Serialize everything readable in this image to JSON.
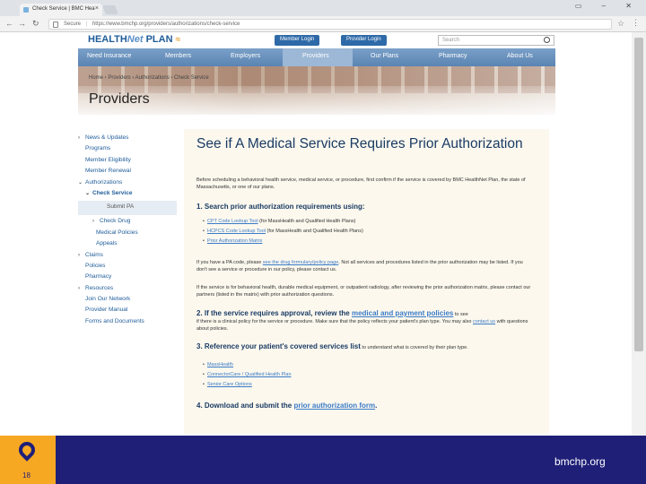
{
  "browser": {
    "tab_title": "Check Service | BMC Hea",
    "tab_close": "×",
    "url_secure": "Secure",
    "url": "https://www.bmchp.org/providers/authorizations/check-service",
    "window_controls": "▭ – ✕"
  },
  "site": {
    "logo_text_1": "HEALTH",
    "logo_text_2": "Net",
    "logo_text_3": " PLAN",
    "member_login": "Member Login",
    "provider_login": "Provider Login",
    "search_placeholder": "Search",
    "nav": [
      "Need Insurance",
      "Members",
      "Employers",
      "Providers",
      "Our Plans",
      "Pharmacy",
      "About Us"
    ],
    "breadcrumb": "Home › Providers › Authorizations › Check Service",
    "page_title": "Providers",
    "sidenav": [
      {
        "label": "News & Updates",
        "prefix": "›"
      },
      {
        "label": "Programs",
        "prefix": ""
      },
      {
        "label": "Member Eligibility",
        "prefix": ""
      },
      {
        "label": "Member Renewal",
        "prefix": ""
      },
      {
        "label": "Authorizations",
        "prefix": "⌄"
      },
      {
        "label": "Check Service",
        "prefix": "⌄"
      },
      {
        "label": "Submit PA",
        "prefix": ""
      },
      {
        "label": "Check Drug",
        "prefix": "›"
      },
      {
        "label": "Medical Policies",
        "prefix": ""
      },
      {
        "label": "Appeals",
        "prefix": ""
      },
      {
        "label": "Claims",
        "prefix": "›"
      },
      {
        "label": "Policies",
        "prefix": ""
      },
      {
        "label": "Pharmacy",
        "prefix": ""
      },
      {
        "label": "Resources",
        "prefix": "›"
      },
      {
        "label": "Join Our Network",
        "prefix": ""
      },
      {
        "label": "Provider Manual",
        "prefix": ""
      },
      {
        "label": "Forms and Documents",
        "prefix": ""
      }
    ],
    "content": {
      "heading": "See if A Medical Service Requires Prior Authorization",
      "intro": "Before scheduling a behavioral health service, medical service, or procedure, first confirm if the service is covered by BMC HealthNet Plan, the state of Massachusetts, or one of our plans.",
      "step1": "1. Search prior authorization requirements using:",
      "step1_links": [
        {
          "link": "CPT Code Lookup Tool",
          "rest": " (for MassHealth and Qualified Health Plans)"
        },
        {
          "link": "HCPCS Code Lookup Tool",
          "rest": " (for MassHealth and Qualified Health Plans)"
        },
        {
          "link": "Prior Authorization Matrix",
          "rest": ""
        }
      ],
      "para_a_1": "If you have a PA code, please ",
      "para_a_link": "see the drug formulary/policy page",
      "para_a_2": ". Not all services and procedures listed in the prior authorization may be listed. If you don't see a service or procedure in our policy, please contact us.",
      "para_b": "If the service is for behavioral health, durable medical equipment, or outpatient radiology, after reviewing the prior authorization matrix, please contact our partners (listed in the matrix) with prior authorization questions.",
      "step2_a": "2. If the service requires approval, review the ",
      "step2_link": "medical and payment policies",
      "step2_tail": " to see",
      "step2_body_1": "if there is a clinical policy for the service or procedure. Make sure that the policy reflects your patient's plan type. You may also ",
      "step2_body_link": "contact us",
      "step2_body_2": " with questions about policies.",
      "step3_a": "3. Reference your patient's covered services list",
      "step3_tail": " to understand what is covered by their plan type.",
      "step3_links": [
        "MassHealth",
        "ConnectorCare / Qualified Health Plan",
        "Senior Care Options"
      ],
      "step4_a": "4. Download and submit the ",
      "step4_link": "prior authorization form",
      "step4_b": "."
    }
  },
  "footer": {
    "slide_number": "18",
    "brand": "bmchp.org",
    "accent": "#f7a823",
    "background": "#1f1f78"
  }
}
